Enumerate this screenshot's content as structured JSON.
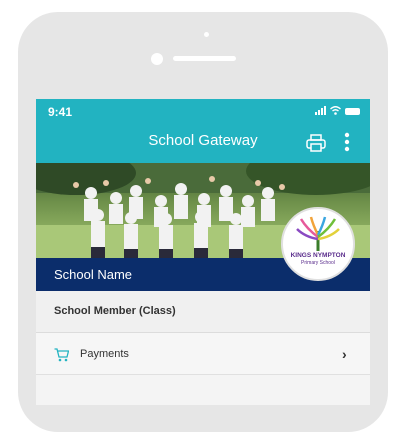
{
  "status_bar": {
    "time": "9:41"
  },
  "header": {
    "title": "School Gateway"
  },
  "school": {
    "name": "School Name",
    "logo_line1": "KINGS NYMPTON",
    "logo_line2": "Primary School"
  },
  "member": {
    "label": "School Member (Class)"
  },
  "menu": {
    "items": [
      {
        "label": "Payments",
        "icon": "cart-icon",
        "chevron": "›"
      }
    ]
  },
  "colors": {
    "header": "#22b3c1",
    "school_bar": "#0b2d6b",
    "accent_icon": "#22b3c1"
  }
}
